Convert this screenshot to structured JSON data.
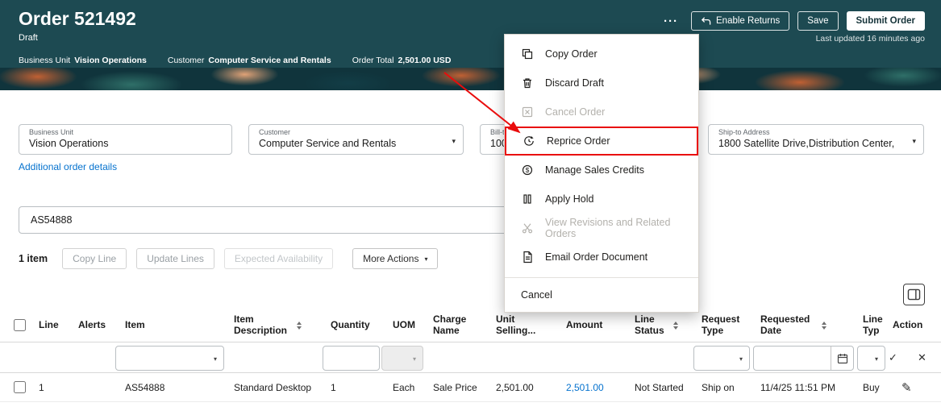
{
  "colors": {
    "header_bg": "#1d4a52",
    "accent_red": "#e90c0c",
    "link_blue": "#0572ce"
  },
  "icons": {
    "chevron_down": "▾",
    "check": "✓",
    "close": "✕",
    "edit_pencil": "✎",
    "return_arrow": "↩"
  },
  "header": {
    "title": "Order 521492",
    "status": "Draft",
    "meta": [
      {
        "label": "Business Unit",
        "value": "Vision Operations"
      },
      {
        "label": "Customer",
        "value": "Computer Service and Rentals"
      },
      {
        "label": "Order Total",
        "value": "2,501.00 USD"
      }
    ],
    "actions": {
      "more": "···",
      "enable_returns": "Enable Returns",
      "save": "Save",
      "submit": "Submit Order"
    },
    "last_updated": "Last updated 16 minutes ago"
  },
  "menu": {
    "items": [
      {
        "label": "Copy Order",
        "icon": "copy-icon",
        "disabled": false,
        "highlighted": false
      },
      {
        "label": "Discard Draft",
        "icon": "trash-icon",
        "disabled": false,
        "highlighted": false
      },
      {
        "label": "Cancel Order",
        "icon": "cancel-square-icon",
        "disabled": true,
        "highlighted": false
      },
      {
        "label": "Reprice Order",
        "icon": "reprice-icon",
        "disabled": false,
        "highlighted": true
      },
      {
        "label": "Manage Sales Credits",
        "icon": "sales-credits-icon",
        "disabled": false,
        "highlighted": false
      },
      {
        "label": "Apply Hold",
        "icon": "hold-icon",
        "disabled": false,
        "highlighted": false
      },
      {
        "label": "View Revisions and Related Orders",
        "icon": "scissors-icon",
        "disabled": true,
        "highlighted": false
      },
      {
        "label": "Email Order Document",
        "icon": "document-icon",
        "disabled": false,
        "highlighted": false
      }
    ],
    "cancel_label": "Cancel"
  },
  "form": {
    "business_unit": {
      "label": "Business Unit",
      "value": "Vision Operations"
    },
    "customer": {
      "label": "Customer",
      "value": "Computer Service and Rentals"
    },
    "bill_to": {
      "label": "Bill-to",
      "value": "100"
    },
    "ship_to": {
      "label": "Ship-to Address",
      "value": "1800 Satellite Drive,Distribution Center,"
    },
    "additional_details_link": "Additional order details"
  },
  "search": {
    "value": "AS54888"
  },
  "toolbar": {
    "item_count": "1 item",
    "copy_line": "Copy Line",
    "update_lines": "Update Lines",
    "expected_availability": "Expected Availability",
    "more_actions": "More Actions"
  },
  "table": {
    "columns": [
      {
        "label": "Line"
      },
      {
        "label": "Alerts"
      },
      {
        "label": "Item"
      },
      {
        "label": "Item Description",
        "sortable": true
      },
      {
        "label": "Quantity"
      },
      {
        "label": "UOM"
      },
      {
        "label": "Charge Name"
      },
      {
        "label": "Unit Selling..."
      },
      {
        "label": "Amount"
      },
      {
        "label": "Line Status",
        "sortable": true
      },
      {
        "label": "Request Type"
      },
      {
        "label": "Requested Date",
        "sortable": true
      },
      {
        "label": "Line Typ"
      },
      {
        "label": "Action"
      }
    ],
    "row": {
      "line": "1",
      "item": "AS54888",
      "description": "Standard Desktop",
      "quantity": "1",
      "uom": "Each",
      "charge_name": "Sale Price",
      "unit_selling": "2,501.00",
      "amount": "2,501.00",
      "line_status": "Not Started",
      "request_type": "Ship on",
      "requested_date": "11/4/25 11:51 PM",
      "line_type": "Buy"
    }
  }
}
